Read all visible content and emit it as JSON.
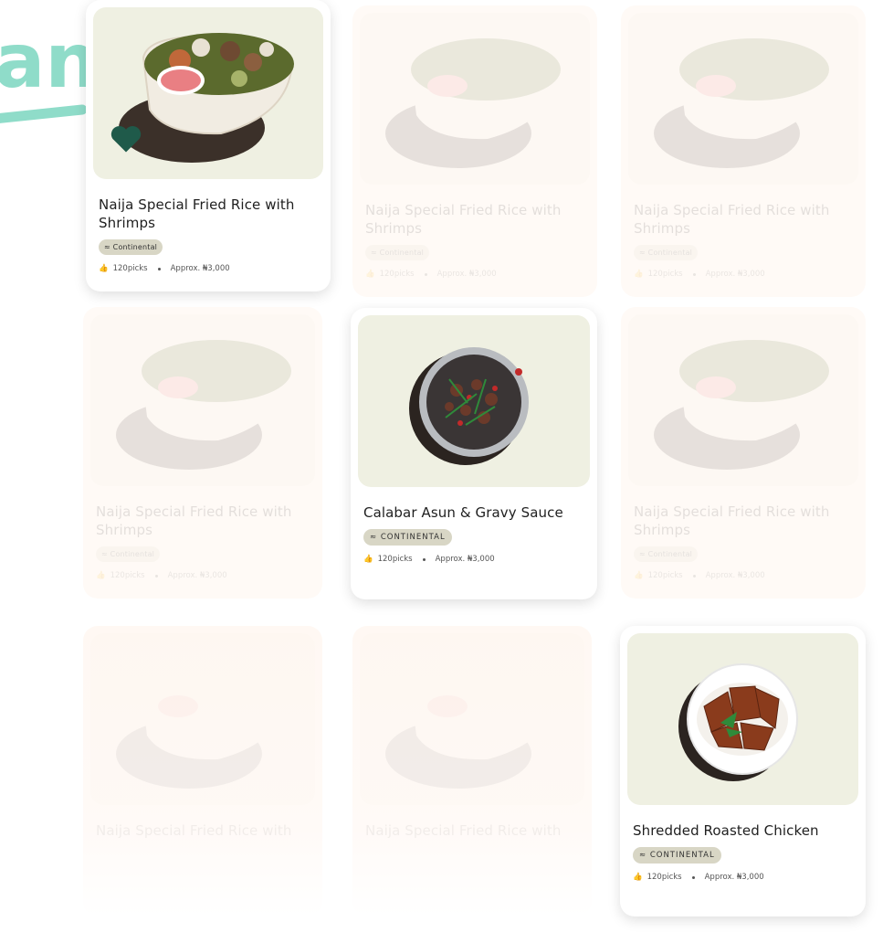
{
  "decoration": {
    "text": "an"
  },
  "cards": [
    {
      "title": "Naija Special Fried Rice with Shrimps",
      "badge": "Continental",
      "picks": "120picks",
      "price": "Approx. ₦3,000",
      "image": "rice-bowl-icon"
    },
    {
      "title": "Naija Special Fried Rice with Shrimps",
      "badge": "Continental",
      "picks": "120picks",
      "price": "Approx. ₦3,000",
      "image": "rice-bowl-icon"
    },
    {
      "title": "Naija Special Fried Rice with Shrimps",
      "badge": "Continental",
      "picks": "120picks",
      "price": "Approx. ₦3,000",
      "image": "rice-bowl-icon"
    },
    {
      "title": "Naija Special Fried Rice with Shrimps",
      "badge": "Continental",
      "picks": "120picks",
      "price": "Approx. ₦3,000",
      "image": "rice-bowl-icon"
    },
    {
      "title": "Calabar Asun & Gravy Sauce",
      "badge": "CONTINENTAL",
      "picks": "120picks",
      "price": "Approx. ₦3,000",
      "image": "asun-pan-icon"
    },
    {
      "title": "Naija Special Fried Rice with Shrimps",
      "badge": "Continental",
      "picks": "120picks",
      "price": "Approx. ₦3,000",
      "image": "rice-bowl-icon"
    },
    {
      "title": "Naija Special Fried Rice with",
      "badge": "",
      "picks": "",
      "price": "",
      "image": "rice-bowl-icon"
    },
    {
      "title": "Naija Special Fried Rice with",
      "badge": "",
      "picks": "",
      "price": "",
      "image": "rice-bowl-icon"
    },
    {
      "title": "Shredded Roasted Chicken",
      "badge": "CONTINENTAL",
      "picks": "120picks",
      "price": "Approx. ₦3,000",
      "image": "roasted-chicken-icon"
    }
  ],
  "colors": {
    "accent": "#8fdcc9",
    "heart": "#1f5a4a",
    "badge_bg": "#d8d6c5",
    "image_bg": "#eff0e2"
  }
}
